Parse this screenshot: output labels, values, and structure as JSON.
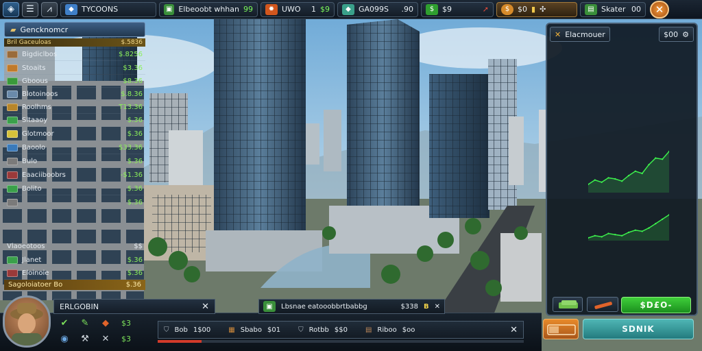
{
  "topbar": {
    "menu_icon": "menu-icon",
    "title": "TYCOONS",
    "res1": {
      "label": "Elbeoobt whhan",
      "value": "99"
    },
    "res2": {
      "label": "UWO",
      "amount": "1",
      "value": "$9"
    },
    "res3": {
      "label": "GA099S",
      "value": ".90"
    },
    "res4": {
      "value": "$9"
    },
    "gold": {
      "value": "$0"
    },
    "cash": {
      "label": "Skater",
      "value": "00"
    }
  },
  "panel": {
    "title": "Elacmouer",
    "counter": "$00",
    "subtitle": "Gencknomcr",
    "header_left": "Bril Gaceuloas",
    "header_right": "$.5836",
    "rows": [
      {
        "label": "Bigdiclbos",
        "value": "$.8256",
        "color": "#9a6b3a"
      },
      {
        "label": "Stoaits",
        "value": "$3.36",
        "color": "#c07a2a"
      },
      {
        "label": "Gboous",
        "value": "$8.36",
        "color": "#3a9a3a"
      },
      {
        "label": "Blotoinoos",
        "value": "$.8.36",
        "color": "#6a8aaa"
      },
      {
        "label": "Roolhms",
        "value": "T13.36",
        "color": "#b8862a"
      },
      {
        "label": "Sltaaoy",
        "value": "$.36",
        "color": "#3aa04a"
      },
      {
        "label": "Glotmoor",
        "value": "$.36",
        "color": "#d6c23a"
      },
      {
        "label": "Baoolo",
        "value": "$33.36",
        "color": "#3a7aba"
      },
      {
        "label": "Bulo",
        "value": "$.36",
        "color": "#7a7a7a"
      },
      {
        "label": "Eaaciiboobrs",
        "value": "-$1.36",
        "color": "#9a3a3a"
      },
      {
        "label": "Bolito",
        "value": "$.36",
        "color": "#3aa04a"
      },
      {
        "label": "",
        "value": "$.36",
        "color": "#7a7a7a"
      }
    ],
    "footer1_label": "Vlaoeotoos",
    "footer1_value": "$$",
    "rows2": [
      {
        "label": "Jlanet",
        "value": "$.36",
        "color": "#3aa04a"
      },
      {
        "label": "Eloinoie",
        "value": "$.36",
        "color": "#9a3a3a"
      }
    ],
    "footer2_label": "Sagoloiatoer Bo",
    "footer2_value": "$.36",
    "go_button": "$D£O-",
    "main_button": "SDNIK"
  },
  "bottom": {
    "player_name": "ERLGOBIN",
    "notification": "Lbsnae eatooobbrtbabbg",
    "notification_value": "$338",
    "notification_badge": "B",
    "stats": [
      {
        "icon": "shield-icon",
        "label": "Bob",
        "value": "1$00"
      },
      {
        "icon": "crate-icon",
        "label": "Sbabo",
        "value": "$01"
      },
      {
        "icon": "shield-icon",
        "label": "Rotbb",
        "value": "$$0"
      },
      {
        "icon": "book-icon",
        "label": "Riboo",
        "value": "$oo"
      }
    ],
    "mini_icon_values": [
      "$3",
      "$3"
    ]
  },
  "chart_data": {
    "type": "line",
    "series": [
      {
        "values": [
          10,
          14,
          12,
          16,
          15,
          13,
          18,
          22,
          20,
          28,
          34,
          33,
          40
        ]
      },
      {
        "values": [
          5,
          7,
          6,
          9,
          8,
          7,
          10,
          12,
          11,
          14,
          18,
          22,
          26
        ]
      }
    ],
    "colors": [
      "#3cf04c",
      "#3cf04c"
    ]
  }
}
